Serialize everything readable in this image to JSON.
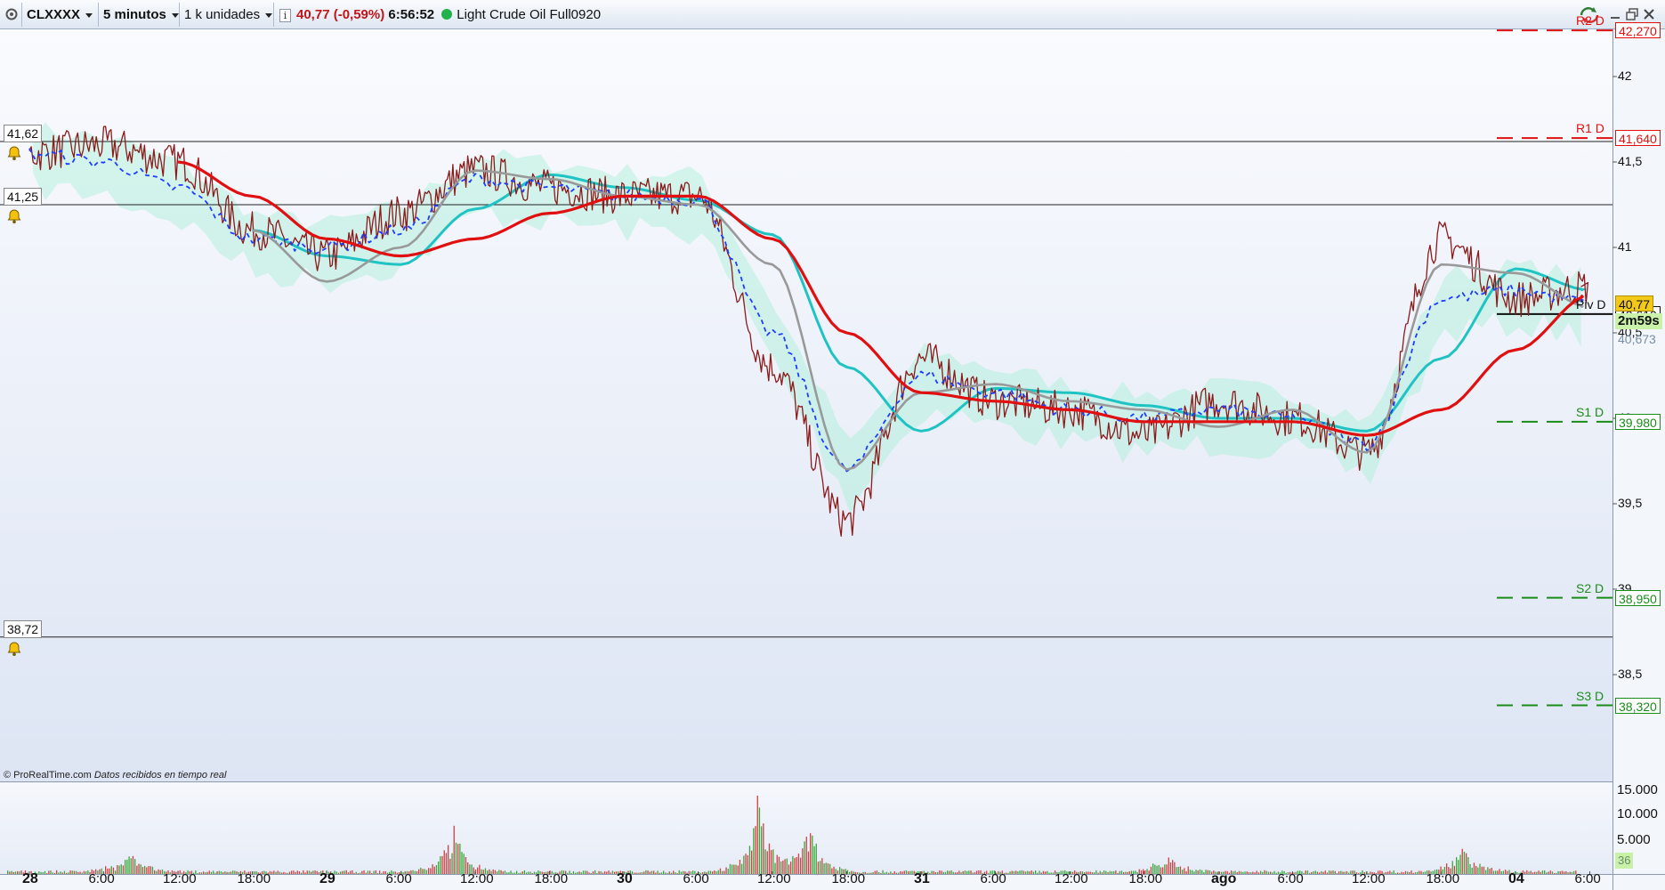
{
  "toolbar": {
    "symbol": "CLXXXX",
    "timeframe": "5 minutos",
    "units": "1 k unidades",
    "price": "40,77",
    "change": "(-0,59%)",
    "time": "6:56:52",
    "instrument": "Light Crude Oil Full0920"
  },
  "colors": {
    "price_line": "#8b1a1a",
    "ma_red": "#e01010",
    "ma_cyan": "#1fc3c3",
    "ma_gray": "#999999",
    "ma_dashed_blue": "#1f3cff",
    "cloud": "#a8f0d6",
    "resistance": "#e01010",
    "support": "#1a8c1a"
  },
  "price_axis": {
    "ticks": [
      "42",
      "41,5",
      "41",
      "40,5",
      "40",
      "39,5",
      "39",
      "38,5"
    ],
    "current_price": "40,77",
    "countdown": "2m59s",
    "ma_value": "40,673"
  },
  "pivots": [
    {
      "name": "R2 D",
      "value": "42,270",
      "price": 42.27,
      "kind": "resistance"
    },
    {
      "name": "R1 D",
      "value": "41,640",
      "price": 41.64,
      "kind": "resistance"
    },
    {
      "name": "Piv D",
      "value": "40,610",
      "price": 40.61,
      "kind": "pivot"
    },
    {
      "name": "S1 D",
      "value": "39,980",
      "price": 39.98,
      "kind": "support"
    },
    {
      "name": "S2 D",
      "value": "38,950",
      "price": 38.95,
      "kind": "support"
    },
    {
      "name": "S3 D",
      "value": "38,320",
      "price": 38.32,
      "kind": "support"
    }
  ],
  "alert_levels": [
    {
      "label": "41,62",
      "price": 41.62
    },
    {
      "label": "41,25",
      "price": 41.25
    },
    {
      "label": "38,72",
      "price": 38.72
    }
  ],
  "footer": {
    "brand": "© ProRealTime.com",
    "note": "Datos recibidos en tiempo real"
  },
  "volume_axis": {
    "ticks": [
      "15.000",
      "10.000",
      "5.000"
    ],
    "last_volume": "36"
  },
  "time_axis": [
    {
      "label": "28",
      "day": true
    },
    {
      "label": "6:00",
      "day": false
    },
    {
      "label": "12:00",
      "day": false
    },
    {
      "label": "18:00",
      "day": false
    },
    {
      "label": "29",
      "day": true
    },
    {
      "label": "6:00",
      "day": false
    },
    {
      "label": "12:00",
      "day": false
    },
    {
      "label": "18:00",
      "day": false
    },
    {
      "label": "30",
      "day": true
    },
    {
      "label": "6:00",
      "day": false
    },
    {
      "label": "12:00",
      "day": false
    },
    {
      "label": "18:00",
      "day": false
    },
    {
      "label": "31",
      "day": true
    },
    {
      "label": "6:00",
      "day": false
    },
    {
      "label": "12:00",
      "day": false
    },
    {
      "label": "18:00",
      "day": false
    },
    {
      "label": "ago",
      "day": true
    },
    {
      "label": "6:00",
      "day": false
    },
    {
      "label": "12:00",
      "day": false
    },
    {
      "label": "18:00",
      "day": false
    },
    {
      "label": "04",
      "day": true
    },
    {
      "label": "6:00",
      "day": false
    }
  ],
  "chart_data": {
    "type": "line",
    "ylim": [
      38.0,
      42.6
    ],
    "x": [
      "28 00:00",
      "28 06:00",
      "28 12:00",
      "28 18:00",
      "29 00:00",
      "29 06:00",
      "29 12:00",
      "29 18:00",
      "30 00:00",
      "30 06:00",
      "30 12:00",
      "30 18:00",
      "31 00:00",
      "31 06:00",
      "31 12:00",
      "31 18:00",
      "ago 00:00",
      "ago 06:00",
      "ago 12:00",
      "ago 18:00",
      "04 00:00",
      "04 06:00"
    ],
    "series": [
      {
        "values": [
          41.55,
          41.6,
          41.5,
          41.1,
          40.95,
          41.2,
          41.45,
          41.35,
          41.3,
          41.3,
          40.3,
          39.4,
          40.35,
          40.1,
          40.05,
          39.9,
          40.1,
          40.0,
          39.8,
          41.05,
          40.7,
          40.77
        ]
      },
      {
        "values": [
          41.55,
          41.5,
          41.35,
          41.05,
          41.0,
          41.1,
          41.4,
          41.35,
          41.3,
          41.28,
          40.5,
          39.7,
          40.25,
          40.15,
          40.05,
          40.0,
          40.05,
          40.0,
          39.85,
          40.7,
          40.75,
          40.68
        ]
      },
      {
        "values": [
          null,
          null,
          null,
          41.1,
          40.8,
          41.0,
          41.45,
          41.4,
          41.3,
          41.25,
          40.9,
          39.7,
          40.15,
          40.2,
          40.1,
          40.05,
          39.95,
          40.05,
          39.8,
          40.9,
          40.85,
          40.65
        ]
      },
      {
        "values": [
          null,
          null,
          41.5,
          41.3,
          41.05,
          40.95,
          41.05,
          41.2,
          41.3,
          41.3,
          41.05,
          40.5,
          40.15,
          40.1,
          40.05,
          39.98,
          39.98,
          39.98,
          39.9,
          40.05,
          40.4,
          40.72
        ]
      }
    ]
  },
  "volume_data": {
    "type": "bar",
    "peaks": [
      {
        "x": "28 14:00",
        "value": 3800
      },
      {
        "x": "29 16:00",
        "value": 8200
      },
      {
        "x": "30 16:30",
        "value": 14000
      },
      {
        "x": "30 20:00",
        "value": 9200
      },
      {
        "x": "31 18:00",
        "value": 2500
      },
      {
        "x": "ago 18:00",
        "value": 4000
      }
    ],
    "ylim": [
      0,
      16000
    ]
  }
}
